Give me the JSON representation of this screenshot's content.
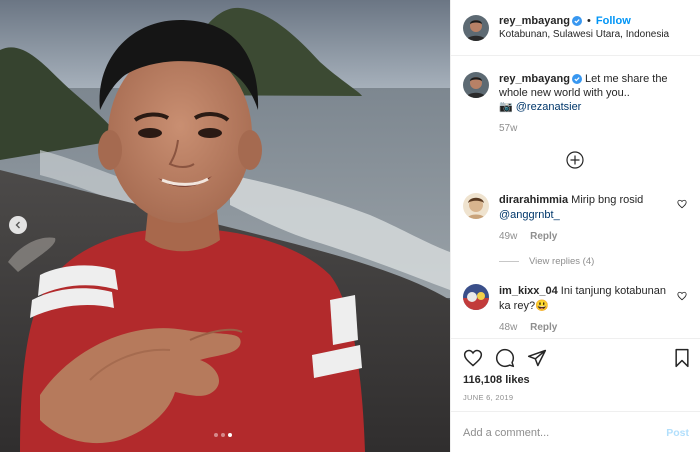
{
  "post": {
    "carousel": {
      "slide_count": 3,
      "active_index": 2
    }
  },
  "header": {
    "username": "rey_mbayang",
    "separator": "•",
    "follow_label": "Follow",
    "location": "Kotabunan, Sulawesi Utara, Indonesia"
  },
  "caption": {
    "username": "rey_mbayang",
    "text": "Let me share the whole new world with you..",
    "camera_emoji": "📷",
    "mention": "@rezanatsier",
    "time": "57w"
  },
  "comments": [
    {
      "username": "dirarahimmia",
      "text": "Mirip bng rosid",
      "mention": "@anggrnbt_",
      "time": "49w",
      "reply_label": "Reply",
      "view_replies": "View replies (4)"
    },
    {
      "username": "im_kixx_04",
      "text": "Ini tanjung kotabunan ka rey?😃",
      "time": "48w",
      "reply_label": "Reply"
    }
  ],
  "actions": {
    "likes": "116,108 likes",
    "date": "JUNE 6, 2019",
    "comment_placeholder": "Add a comment...",
    "post_label": "Post"
  },
  "colors": {
    "accent": "#0095f6",
    "verified": "#3897f0",
    "muted": "#8e8e8e",
    "post_disabled": "#b2dffc"
  }
}
